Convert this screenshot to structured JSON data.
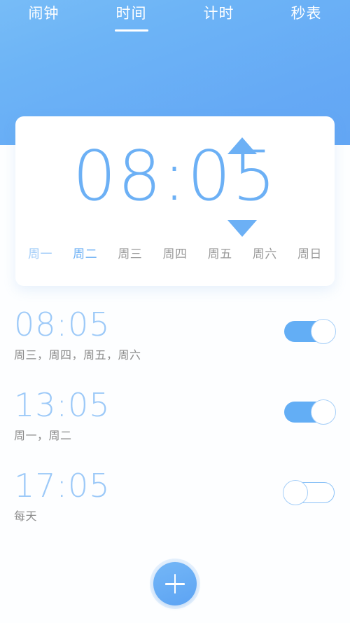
{
  "header": {
    "tabs": [
      {
        "label": "闹钟",
        "active": false
      },
      {
        "label": "时间",
        "active": true
      },
      {
        "label": "计时",
        "active": false
      },
      {
        "label": "秒表",
        "active": false
      }
    ],
    "accent_color": "#63a6f4"
  },
  "picker": {
    "time": "08:05",
    "up_arrow": "stepper-up",
    "down_arrow": "stepper-down",
    "weekdays": [
      {
        "label": "周一",
        "state": "selected-light"
      },
      {
        "label": "周二",
        "state": "selected"
      },
      {
        "label": "周三",
        "state": "normal"
      },
      {
        "label": "周四",
        "state": "normal"
      },
      {
        "label": "周五",
        "state": "normal"
      },
      {
        "label": "周六",
        "state": "normal"
      },
      {
        "label": "周日",
        "state": "normal"
      }
    ],
    "time_color": "#6cb0f5",
    "selected_color": "#6cb0f5",
    "unselected_color": "#9a9a9a"
  },
  "alarms": [
    {
      "time": "08:05",
      "days": "周三，周四，周五，周六",
      "enabled": true
    },
    {
      "time": "13:05",
      "days": "周一，周二",
      "enabled": true
    },
    {
      "time": "17:05",
      "days": "每天",
      "enabled": false
    }
  ],
  "fab": {
    "icon": "plus-icon",
    "label": "+"
  }
}
